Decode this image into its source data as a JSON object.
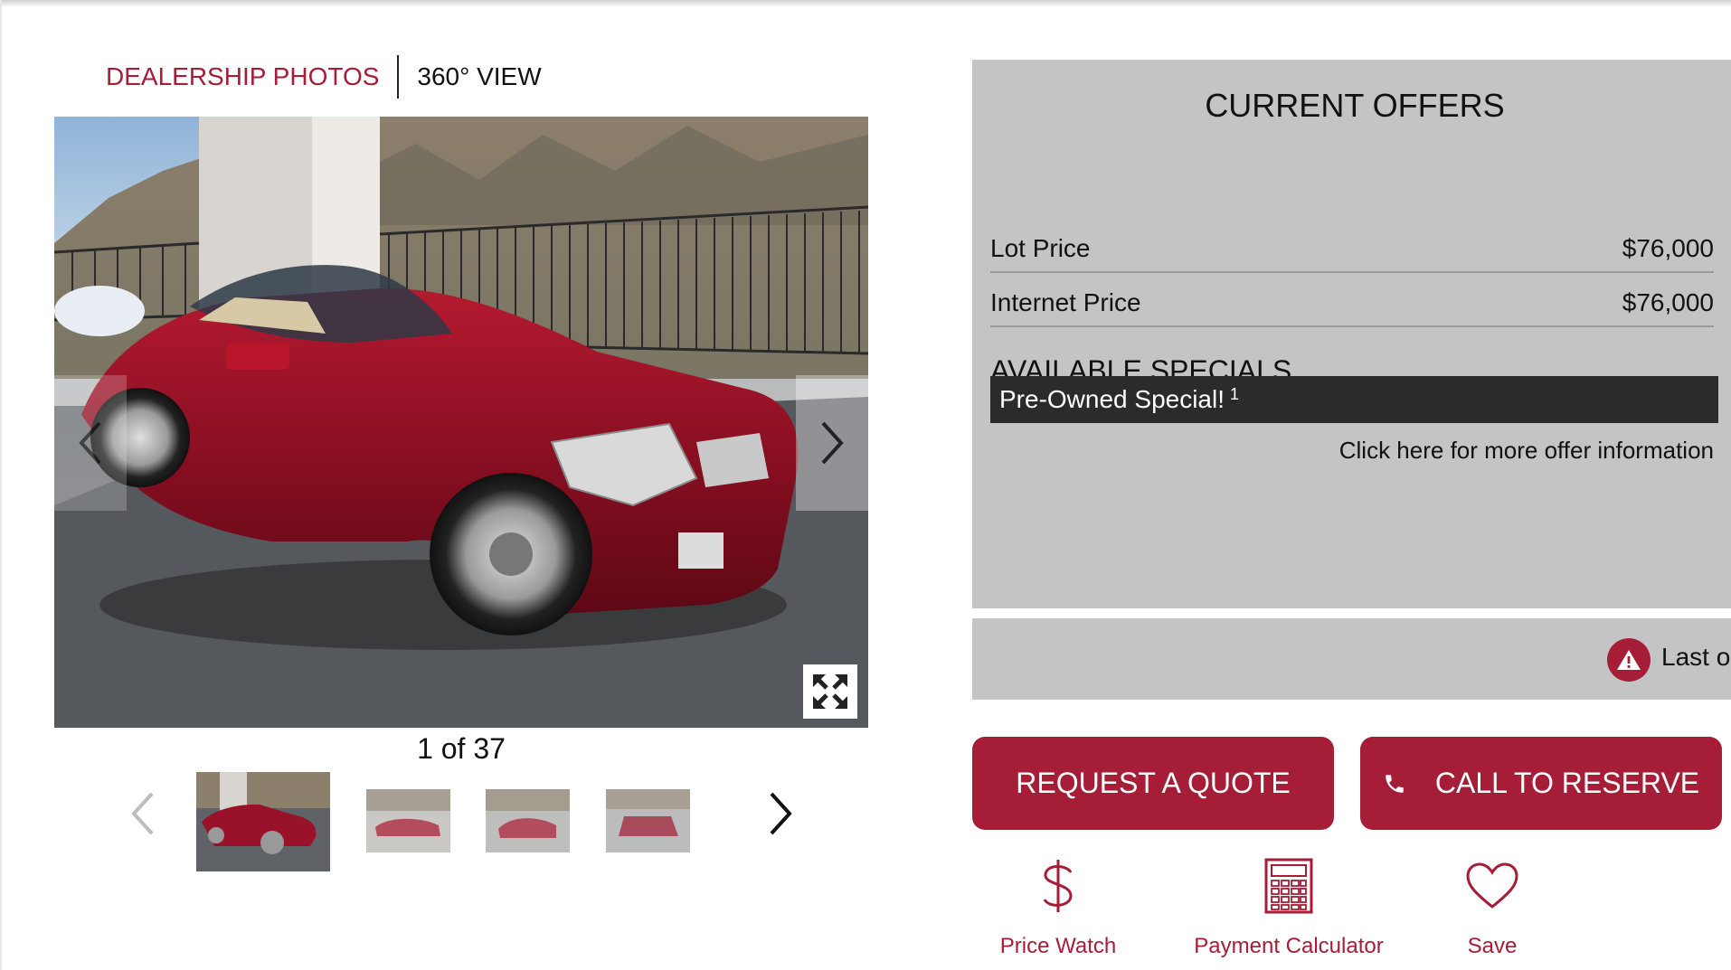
{
  "gallery": {
    "tabs": [
      {
        "label": "DEALERSHIP PHOTOS",
        "active": true
      },
      {
        "label": "360° VIEW",
        "active": false
      }
    ],
    "counter": "1 of 37",
    "thumbnails_visible": 4
  },
  "offers": {
    "title": "CURRENT OFFERS",
    "prices": [
      {
        "label": "Lot Price",
        "value": "$76,000"
      },
      {
        "label": "Internet Price",
        "value": "$76,000"
      }
    ],
    "specials_title": "AVAILABLE SPECIALS",
    "special": {
      "label": "Pre-Owned Special!",
      "footnote": "1"
    },
    "more_info": "Click here for more offer information"
  },
  "alert": {
    "text": "Last o",
    "icon": "warning-icon"
  },
  "buttons": {
    "request_quote": "REQUEST A QUOTE",
    "call_to_reserve": "CALL TO RESERVE"
  },
  "actions": [
    {
      "label": "Price Watch",
      "icon": "dollar-icon"
    },
    {
      "label": "Payment Calculator",
      "icon": "calculator-icon"
    },
    {
      "label": "Save",
      "icon": "heart-icon"
    }
  ],
  "colors": {
    "accent": "#a51d36",
    "panel": "#c4c4c4",
    "special_bar": "#2b2b2b"
  }
}
